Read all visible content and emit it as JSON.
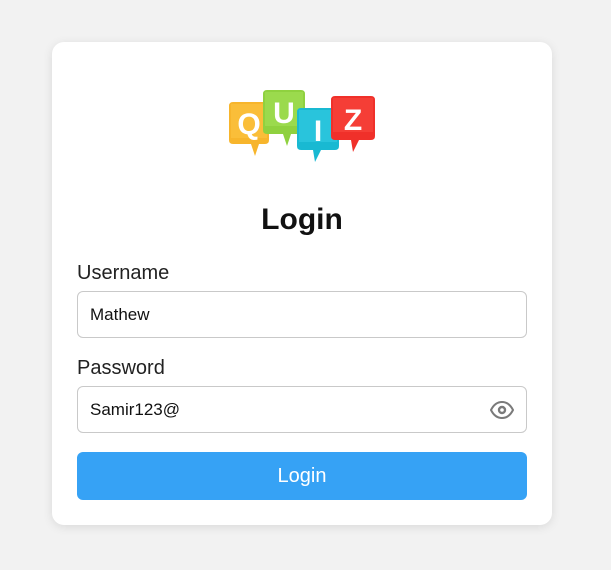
{
  "logo": {
    "letters": [
      "Q",
      "U",
      "I",
      "Z"
    ],
    "colors": [
      "#f7b52c",
      "#8fd13f",
      "#19b9d2",
      "#f0302a"
    ]
  },
  "title": "Login",
  "username": {
    "label": "Username",
    "value": "Mathew"
  },
  "password": {
    "label": "Password",
    "value": "Samir123@",
    "toggle_icon": "eye-icon"
  },
  "login_button": {
    "label": "Login",
    "color": "#36a2f5"
  }
}
